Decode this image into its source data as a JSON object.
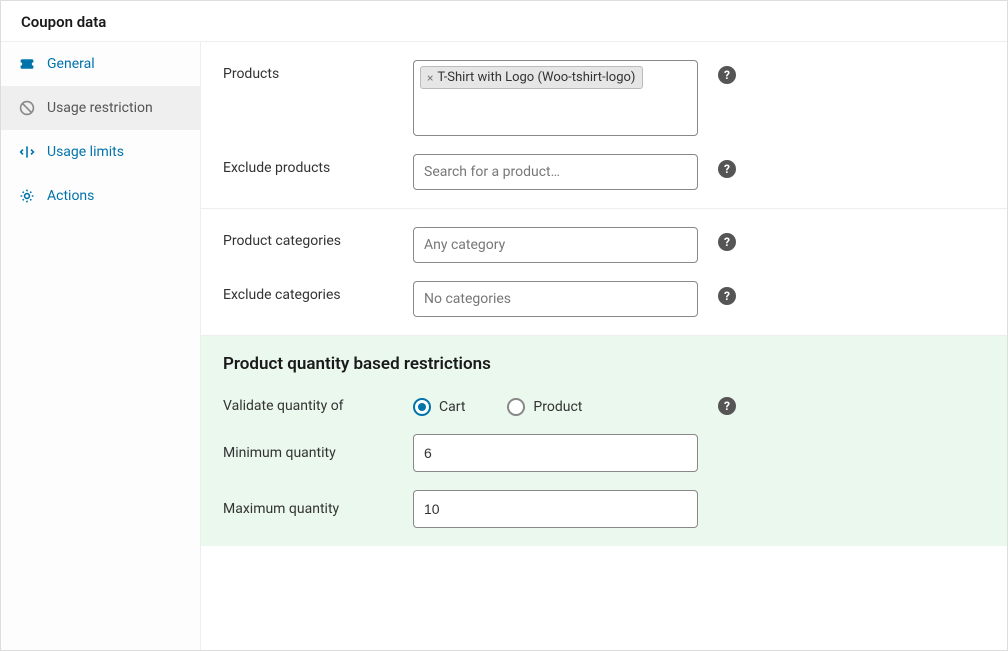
{
  "panel": {
    "title": "Coupon data"
  },
  "sidebar": {
    "items": [
      {
        "label": "General"
      },
      {
        "label": "Usage restriction"
      },
      {
        "label": "Usage limits"
      },
      {
        "label": "Actions"
      }
    ]
  },
  "fields": {
    "products": {
      "label": "Products",
      "tags": [
        "T-Shirt with Logo (Woo-tshirt-logo)"
      ]
    },
    "exclude_products": {
      "label": "Exclude products",
      "placeholder": "Search for a product…"
    },
    "product_categories": {
      "label": "Product categories",
      "placeholder": "Any category"
    },
    "exclude_categories": {
      "label": "Exclude categories",
      "placeholder": "No categories"
    }
  },
  "qty": {
    "heading": "Product quantity based restrictions",
    "validate_label": "Validate quantity of",
    "options": {
      "cart": "Cart",
      "product": "Product"
    },
    "selected": "cart",
    "min_label": "Minimum quantity",
    "min_value": "6",
    "max_label": "Maximum quantity",
    "max_value": "10"
  },
  "help_glyph": "?"
}
